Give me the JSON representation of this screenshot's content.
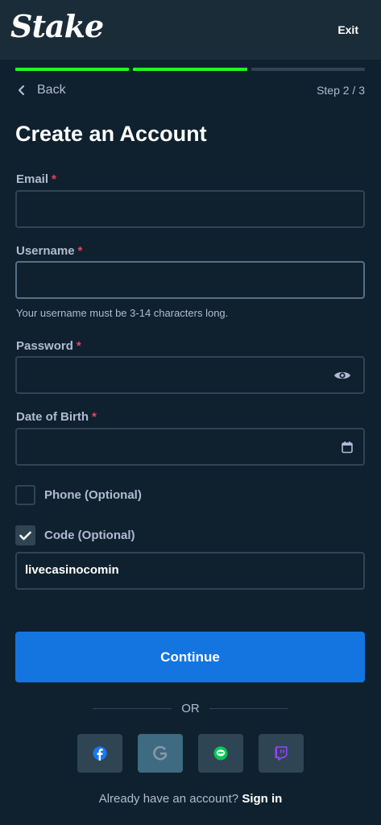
{
  "header": {
    "logo_text": "Stake",
    "exit_label": "Exit"
  },
  "progress": {
    "current_step": 2,
    "total_steps": 3
  },
  "nav": {
    "back_label": "Back",
    "step_label": "Step 2 / 3"
  },
  "form": {
    "title": "Create an Account",
    "required_marker": "*",
    "email": {
      "label": "Email",
      "value": ""
    },
    "username": {
      "label": "Username",
      "value": "",
      "hint": "Your username must be 3-14 characters long."
    },
    "password": {
      "label": "Password",
      "value": ""
    },
    "dob": {
      "label": "Date of Birth",
      "value": ""
    },
    "phone": {
      "label": "Phone (Optional)",
      "checked": false
    },
    "code": {
      "label": "Code (Optional)",
      "checked": true,
      "value": "livecasinocomin"
    }
  },
  "actions": {
    "continue_label": "Continue",
    "or_label": "OR",
    "socials": [
      "facebook-icon",
      "google-icon",
      "line-icon",
      "twitch-icon"
    ],
    "signin_prompt": "Already have an account?",
    "signin_link": "Sign in"
  },
  "colors": {
    "background": "#0f212e",
    "header": "#1a2c38",
    "progress_done": "#1fff20",
    "button": "#1475e1",
    "required": "#ed4163"
  }
}
